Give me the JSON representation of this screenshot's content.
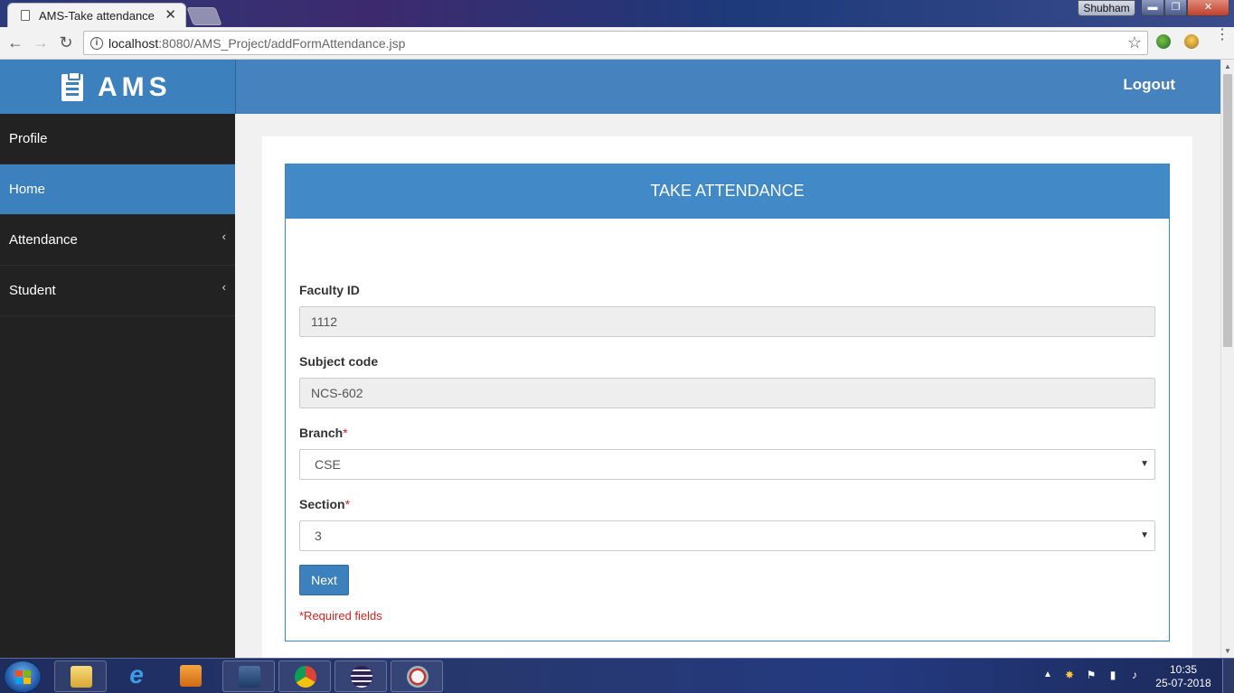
{
  "browser": {
    "tab_title": "AMS-Take attendance",
    "tab_close": "✕",
    "url_host": "localhost",
    "url_path": ":8080/AMS_Project/addFormAttendance.jsp",
    "window_user": "Shubham",
    "min_glyph": "▬",
    "max_glyph": "❐",
    "close_glyph": "✕",
    "back_glyph": "←",
    "forward_glyph": "→",
    "reload_glyph": "↻",
    "info_glyph": "i",
    "star_glyph": "☆",
    "menu_glyph": "⋮"
  },
  "app": {
    "brand": "AMS",
    "logout_label": "Logout",
    "accent_color": "#3c81bd"
  },
  "sidebar": {
    "items": [
      {
        "label": "Profile",
        "icon": "none"
      },
      {
        "label": "Home",
        "icon": "none",
        "active": true
      },
      {
        "label": "Attendance",
        "icon": "chevron-left-icon",
        "chevron": "‹"
      },
      {
        "label": "Student",
        "icon": "chevron-left-icon",
        "chevron": "‹"
      }
    ]
  },
  "form": {
    "title": "TAKE ATTENDANCE",
    "faculty_label": "Faculty ID",
    "faculty_value": "1112",
    "subject_label": "Subject code",
    "subject_value": "NCS-602",
    "branch_label": "Branch",
    "branch_value": "CSE",
    "section_label": "Section",
    "section_value": "3",
    "required_mark": "*",
    "select_caret": "▼",
    "next_label": "Next",
    "required_note": "*Required fields"
  },
  "taskbar": {
    "time": "10:35",
    "date": "25-07-2018",
    "tray_arrow": "▲"
  }
}
